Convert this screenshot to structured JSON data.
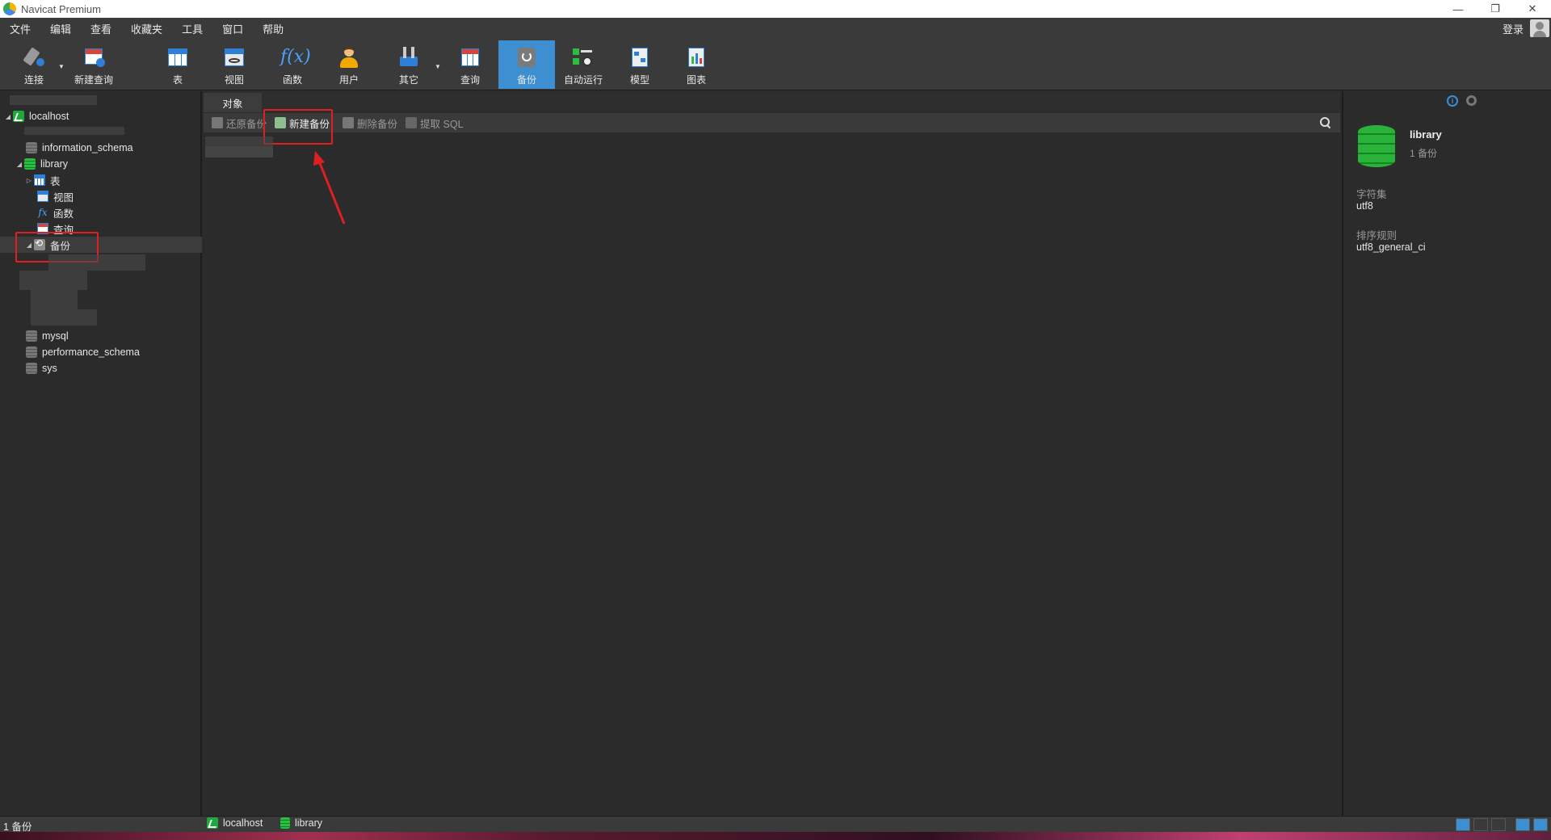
{
  "window": {
    "title": "Navicat Premium",
    "controls": [
      "—",
      "❐",
      "✕"
    ]
  },
  "menu": {
    "items": [
      "文件",
      "编辑",
      "查看",
      "收藏夹",
      "工具",
      "窗口",
      "帮助"
    ],
    "login": "登录"
  },
  "toolbar": {
    "buttons": [
      {
        "label": "连接",
        "icon": "connection-icon"
      },
      {
        "label": "新建查询",
        "icon": "new-query-icon"
      },
      {
        "label": "表",
        "icon": "table-icon"
      },
      {
        "label": "视图",
        "icon": "view-icon"
      },
      {
        "label": "函数",
        "icon": "function-icon"
      },
      {
        "label": "用户",
        "icon": "user-icon"
      },
      {
        "label": "其它",
        "icon": "other-icon"
      },
      {
        "label": "查询",
        "icon": "query-icon"
      },
      {
        "label": "备份",
        "icon": "backup-icon",
        "active": true
      },
      {
        "label": "自动运行",
        "icon": "automation-icon"
      },
      {
        "label": "模型",
        "icon": "model-icon"
      },
      {
        "label": "图表",
        "icon": "chart-icon"
      }
    ],
    "accent": "#3d8fd1"
  },
  "tree": {
    "connection": "localhost",
    "databases": {
      "information_schema": "information_schema",
      "library": "library",
      "mysql": "mysql",
      "performance_schema": "performance_schema",
      "sys": "sys"
    },
    "library_children": {
      "tables": "表",
      "views": "视图",
      "functions": "函数",
      "queries": "查询",
      "backups": "备份"
    }
  },
  "main": {
    "tab": "对象",
    "object_buttons": {
      "restore": "还原备份",
      "new_backup": "新建备份",
      "delete": "删除备份",
      "extract_sql": "提取 SQL"
    }
  },
  "info": {
    "name": "library",
    "sub": "1 备份",
    "charset_label": "字符集",
    "charset_value": "utf8",
    "collation_label": "排序规则",
    "collation_value": "utf8_general_ci"
  },
  "status": {
    "left": "1 备份",
    "connection": "localhost",
    "database": "library"
  },
  "colors": {
    "highlight": "#e02020",
    "db_green": "#29b33b"
  }
}
